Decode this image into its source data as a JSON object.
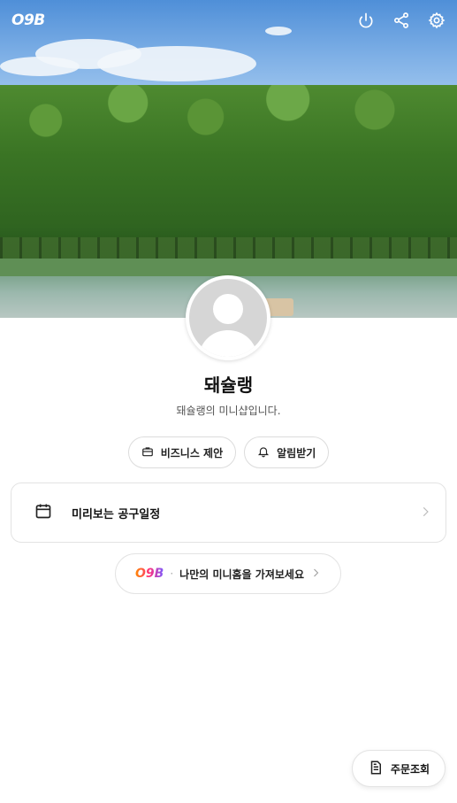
{
  "header": {
    "logo_text": "O9B",
    "icons": [
      "power-icon",
      "share-icon",
      "settings-icon"
    ]
  },
  "profile": {
    "name": "돼슐랭",
    "description": "돼슐랭의 미니샵입니다."
  },
  "actions": {
    "business_label": "비즈니스 제안",
    "notify_label": "알림받기"
  },
  "schedule_card": {
    "label": "미리보는 공구일정"
  },
  "promo": {
    "brand": "O9B",
    "separator": "·",
    "text": "나만의 미니홈을 가져보세요"
  },
  "floating": {
    "order_label": "주문조회"
  },
  "colors": {
    "accent_gradient": [
      "#ff8a00",
      "#ff2e7e",
      "#7b5bff"
    ],
    "border": "#e3e3e3"
  }
}
